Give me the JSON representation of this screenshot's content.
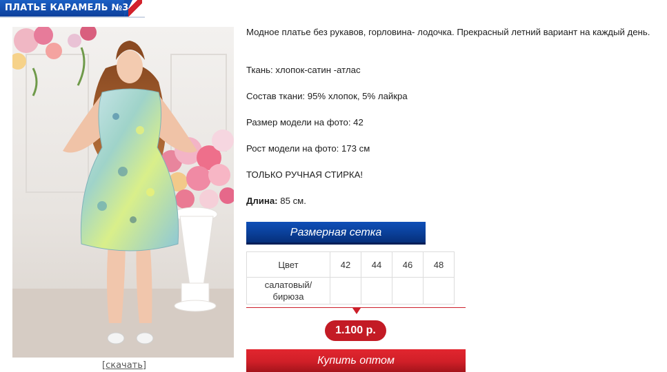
{
  "product": {
    "title": "ПЛАТЬЕ КАРАМЕЛЬ №3",
    "download_label": "[скачать]",
    "description": "Модное платье без рукавов, горловина- лодочка. Прекрасный летний вариант на каждый день.",
    "fabric": "Ткань: хлопок-сатин -атлас",
    "composition": "Состав ткани: 95% хлопок, 5% лайкра",
    "model_size": "Размер модели на фото: 42",
    "model_height": "Рост модели на фото: 173 см",
    "care": "ТОЛЬКО РУЧНАЯ СТИРКА!",
    "length_label": "Длина:",
    "length_value": "85 см."
  },
  "size_chart": {
    "button_label": "Размерная сетка",
    "header_color": "Цвет",
    "sizes": [
      "42",
      "44",
      "46",
      "48"
    ],
    "rows": [
      {
        "color_line1": "салатовый/",
        "color_line2": "бирюза",
        "cells": [
          "",
          "",
          "",
          ""
        ]
      }
    ]
  },
  "price": "1.100 р.",
  "buy_label": "Купить оптом",
  "colors": {
    "brand_blue": "#0d3f9a",
    "accent_red": "#c31b25"
  }
}
